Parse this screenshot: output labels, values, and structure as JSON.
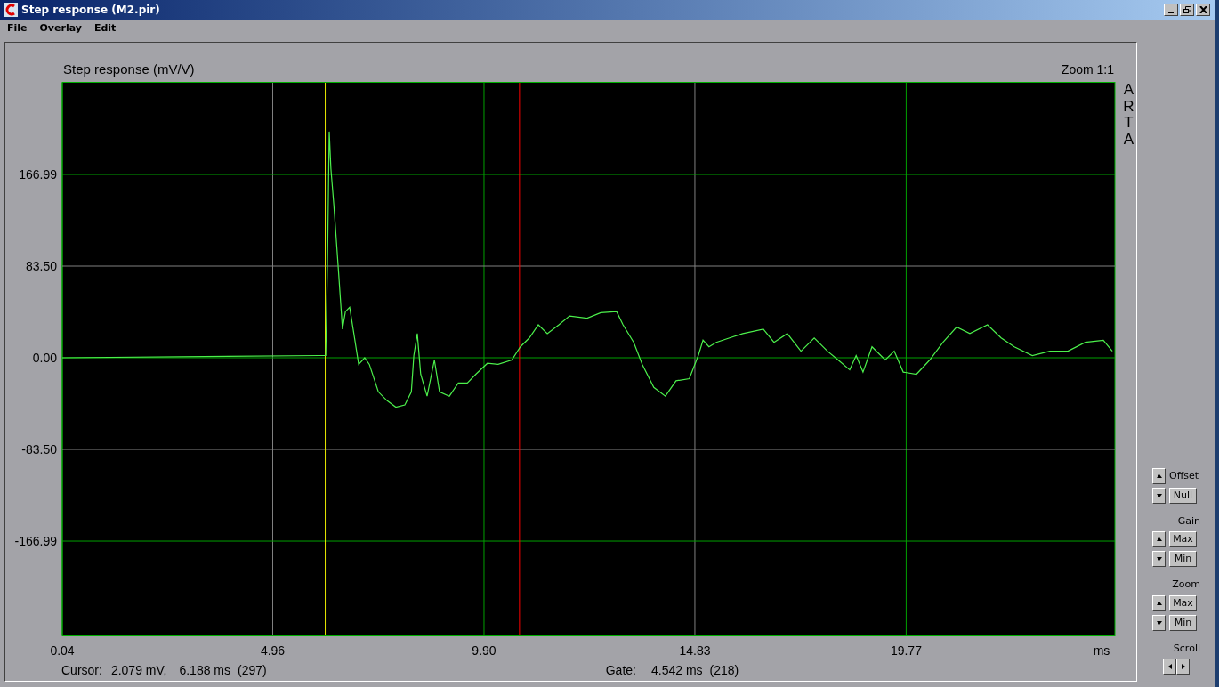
{
  "window": {
    "title": "Step response (M2.pir)"
  },
  "menu": [
    "File",
    "Overlay",
    "Edit"
  ],
  "chart_panel": {
    "zoom_label": "Zoom 1:1",
    "brand": "ARTA",
    "chart_data": {
      "type": "line",
      "title": "Step response (mV/V)",
      "xlabel": "ms",
      "xlim": [
        0.04,
        24.65
      ],
      "ylim": [
        -252.9,
        251.3
      ],
      "grid": true,
      "xticks": [
        0.04,
        4.96,
        {
          "value": 9.9,
          "label": "9.90"
        },
        14.83,
        19.77
      ],
      "yticks": [
        {
          "value": 166.99,
          "label": "166.99"
        },
        {
          "value": 83.5,
          "label": "83.50"
        },
        {
          "value": 0,
          "label": "0.00"
        },
        {
          "value": -83.5,
          "label": "-83.50"
        },
        {
          "value": -166.99,
          "label": "-166.99"
        }
      ],
      "x": [
        0.04,
        6.07,
        6.2,
        6.24,
        6.28,
        6.32,
        6.39,
        6.49,
        6.59,
        6.66,
        6.76,
        6.84,
        6.97,
        7.11,
        7.22,
        7.43,
        7.63,
        7.84,
        8.05,
        8.2,
        8.26,
        8.34,
        8.42,
        8.57,
        8.74,
        8.86,
        9.09,
        9.3,
        9.51,
        9.71,
        9.98,
        10.23,
        10.55,
        10.75,
        10.96,
        11.17,
        11.38,
        11.65,
        11.9,
        12.31,
        12.63,
        13.0,
        13.15,
        13.4,
        13.6,
        13.87,
        14.14,
        14.39,
        14.7,
        14.91,
        15.02,
        15.16,
        15.33,
        15.64,
        15.95,
        16.43,
        16.68,
        16.99,
        17.31,
        17.62,
        17.93,
        18.18,
        18.45,
        18.6,
        18.76,
        18.97,
        19.28,
        19.49,
        19.7,
        20.01,
        20.32,
        20.63,
        20.95,
        21.26,
        21.67,
        21.99,
        22.3,
        22.72,
        23.13,
        23.55,
        23.96,
        24.38,
        24.59
      ],
      "series": [
        {
          "color": "#4cf04c",
          "values": [
            0,
            2,
            2,
            83,
            206,
            172,
            139,
            83,
            26,
            42,
            46,
            26,
            -6,
            0,
            -6,
            -31,
            -39,
            -45,
            -43,
            -31,
            2,
            22,
            -15,
            -35,
            -2,
            -31,
            -35,
            -23,
            -23,
            -15,
            -5,
            -6,
            -2,
            10,
            18,
            30,
            22,
            30,
            38,
            36,
            41,
            42,
            30,
            14,
            -6,
            -27,
            -35,
            -21,
            -19,
            2,
            16,
            10,
            14,
            18,
            22,
            26,
            14,
            22,
            6,
            18,
            6,
            -2,
            -11,
            2,
            -13,
            10,
            -2,
            6,
            -13,
            -15,
            -2,
            14,
            28,
            22,
            30,
            18,
            10,
            2,
            6,
            6,
            14,
            16,
            6
          ]
        }
      ],
      "ref_lines": [
        {
          "axis": "x",
          "value": 6.188,
          "color": "#e8e800"
        },
        {
          "axis": "x",
          "value": 10.73,
          "color": "#ff0000"
        }
      ]
    },
    "status": {
      "cursor_label": "Cursor:",
      "cursor_value": "2.079 mV,",
      "cursor_time": "6.188 ms",
      "cursor_index": "(297)",
      "gate_label": "Gate:",
      "gate_time": "4.542 ms",
      "gate_index": "(218)"
    }
  },
  "controls": [
    {
      "items": [
        {
          "kind": "label",
          "text": "Offset"
        },
        {
          "kind": "button",
          "text": "Null"
        }
      ]
    },
    {
      "title": "Gain",
      "items": [
        {
          "kind": "button",
          "text": "Max"
        },
        {
          "kind": "button",
          "text": "Min"
        }
      ]
    },
    {
      "title": "Zoom",
      "items": [
        {
          "kind": "button",
          "text": "Max"
        },
        {
          "kind": "button",
          "text": "Min"
        }
      ]
    }
  ],
  "scroll": {
    "title": "Scroll"
  }
}
